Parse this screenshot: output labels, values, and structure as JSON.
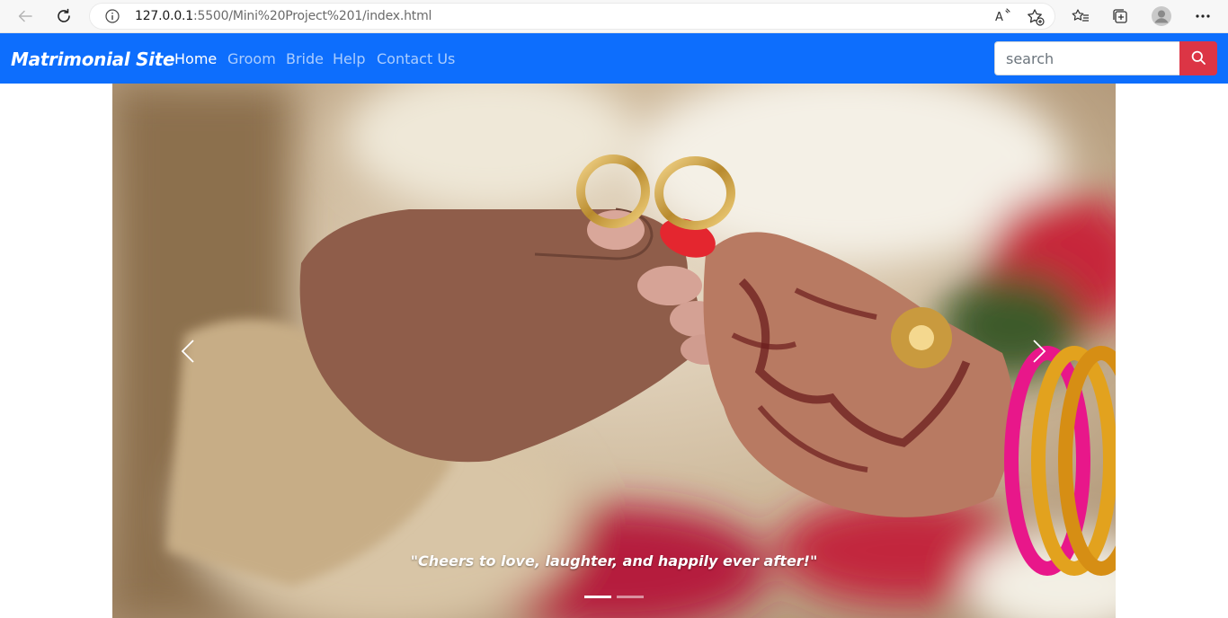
{
  "browser": {
    "url_host": "127.0.0.1",
    "url_path": ":5500/Mini%20Project%201/index.html",
    "icons": [
      "back-icon",
      "refresh-icon",
      "info-icon",
      "read-aloud-icon",
      "add-favorite-icon",
      "favorites-icon",
      "collections-icon",
      "profile-icon",
      "more-icon"
    ]
  },
  "navbar": {
    "brand": "Matrimonial Site",
    "links": [
      {
        "label": "Home",
        "active": true
      },
      {
        "label": "Groom",
        "active": false
      },
      {
        "label": "Bride",
        "active": false
      },
      {
        "label": "Help",
        "active": false
      },
      {
        "label": "Contact Us",
        "active": false
      }
    ],
    "search": {
      "placeholder": "search",
      "value": ""
    },
    "colors": {
      "bg": "#0d6efd",
      "search_button": "#dc3545"
    }
  },
  "carousel": {
    "caption": "\"Cheers to love, laughter, and happily ever after!\"",
    "slide_count": 2,
    "active_slide": 1
  }
}
